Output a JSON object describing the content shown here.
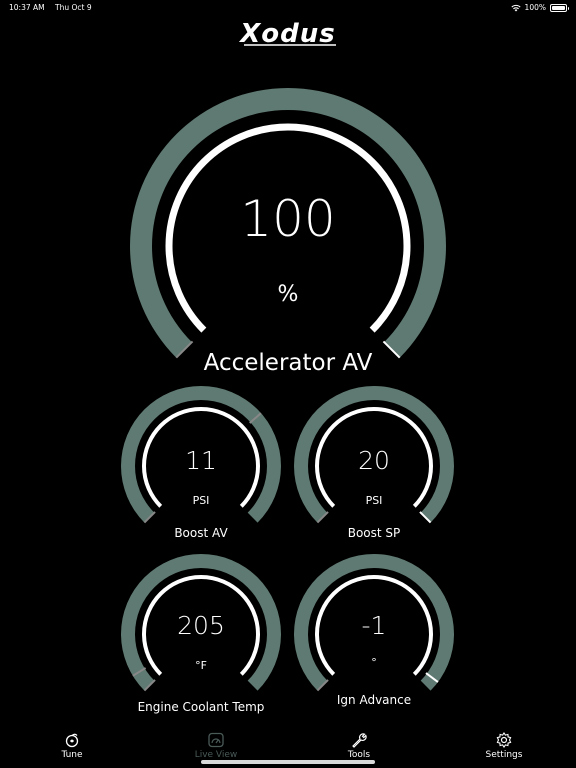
{
  "status_bar": {
    "time": "10:37 AM",
    "date": "Thu Oct 9",
    "battery": "100%"
  },
  "brand": {
    "logo_text": "Xodus"
  },
  "colors": {
    "track": "#5f7a72",
    "ring": "#ffffff",
    "background": "#000000",
    "tick": "#888888"
  },
  "gauges": {
    "main": {
      "value": "100",
      "unit": "%",
      "label": "Accelerator AV",
      "level": 1.0
    },
    "boost_av": {
      "value": "11",
      "unit": "PSI",
      "label": "Boost AV",
      "level": 0.68
    },
    "boost_sp": {
      "value": "20",
      "unit": "PSI",
      "label": "Boost SP",
      "level": 1.0
    },
    "coolant": {
      "value": "205",
      "unit": "°F",
      "label": "Engine Coolant Temp",
      "level": 0.05
    },
    "ign": {
      "value": "-1",
      "unit": "°",
      "label": "Ign Advance",
      "level": 0.97
    }
  },
  "tabs": [
    {
      "label": "Tune",
      "icon": "turbo-icon"
    },
    {
      "label": "Live View",
      "icon": "gauge-icon"
    },
    {
      "label": "Tools",
      "icon": "wrench-icon"
    },
    {
      "label": "Settings",
      "icon": "gear-icon"
    }
  ]
}
